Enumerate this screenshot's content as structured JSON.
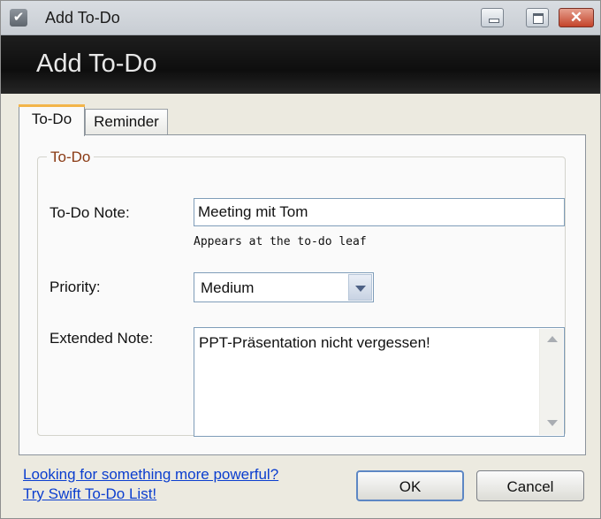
{
  "window": {
    "title": "Add To-Do",
    "app_icon": "checkmark-icon",
    "controls": {
      "minimize": "minimize-icon",
      "maximize": "maximize-icon",
      "close": "close-icon"
    }
  },
  "header": {
    "title": "Add To-Do"
  },
  "tabs": [
    {
      "label": "To-Do",
      "active": true
    },
    {
      "label": "Reminder",
      "active": false
    }
  ],
  "group": {
    "legend": "To-Do",
    "legend_color": "#8a3a14"
  },
  "form": {
    "note_label": "To-Do Note:",
    "note_value": "Meeting mit Tom",
    "note_hint": "Appears at the to-do leaf",
    "priority_label": "Priority:",
    "priority_value": "Medium",
    "extended_label": "Extended Note:",
    "extended_value": "PPT-Präsentation nicht vergessen!"
  },
  "footer": {
    "link_line1": "Looking for something more powerful?",
    "link_line2": "Try Swift To-Do List!",
    "ok_label": "OK",
    "cancel_label": "Cancel"
  },
  "colors": {
    "link": "#0b3ecf",
    "banner": "#111111",
    "tab_accent": "#f3b54a"
  }
}
